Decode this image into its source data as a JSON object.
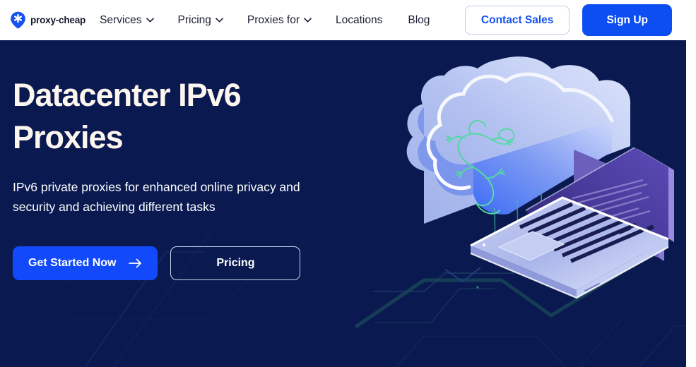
{
  "brand": {
    "logo_icon": "proxy-pin-asterisk-icon",
    "name": "proxy-cheap",
    "accent_blue": "#0c4ef2",
    "hero_bg": "#0a1a50",
    "heading_color": "#fdf6ee"
  },
  "nav": {
    "items": [
      {
        "label": "Services",
        "has_dropdown": true,
        "icon": "chevron-down-icon"
      },
      {
        "label": "Pricing",
        "has_dropdown": true,
        "icon": "chevron-down-icon"
      },
      {
        "label": "Proxies for",
        "has_dropdown": true,
        "icon": "chevron-down-icon"
      },
      {
        "label": "Locations",
        "has_dropdown": false,
        "icon": ""
      },
      {
        "label": "Blog",
        "has_dropdown": false,
        "icon": ""
      }
    ],
    "contact_sales_label": "Contact Sales",
    "sign_up_label": "Sign Up"
  },
  "hero": {
    "title": "Datacenter IPv6 Proxies",
    "subtitle": "IPv6 private proxies for enhanced online privacy and security and achieving different tasks",
    "primary_cta": {
      "label": "Get Started Now",
      "icon": "arrow-right-icon"
    },
    "secondary_cta": {
      "label": "Pricing"
    },
    "illustration": {
      "name": "isometric-cloud-laptop-gecko-illustration",
      "elements": [
        "cloud",
        "gecko-outline",
        "connection-lines",
        "laptop",
        "circuit-traces"
      ],
      "cloud_color_top": "#b9c6f0",
      "cloud_color_front": "#4f74ef",
      "gecko_color": "#4ad6a0",
      "laptop_screen_color": "#463a9a"
    }
  }
}
